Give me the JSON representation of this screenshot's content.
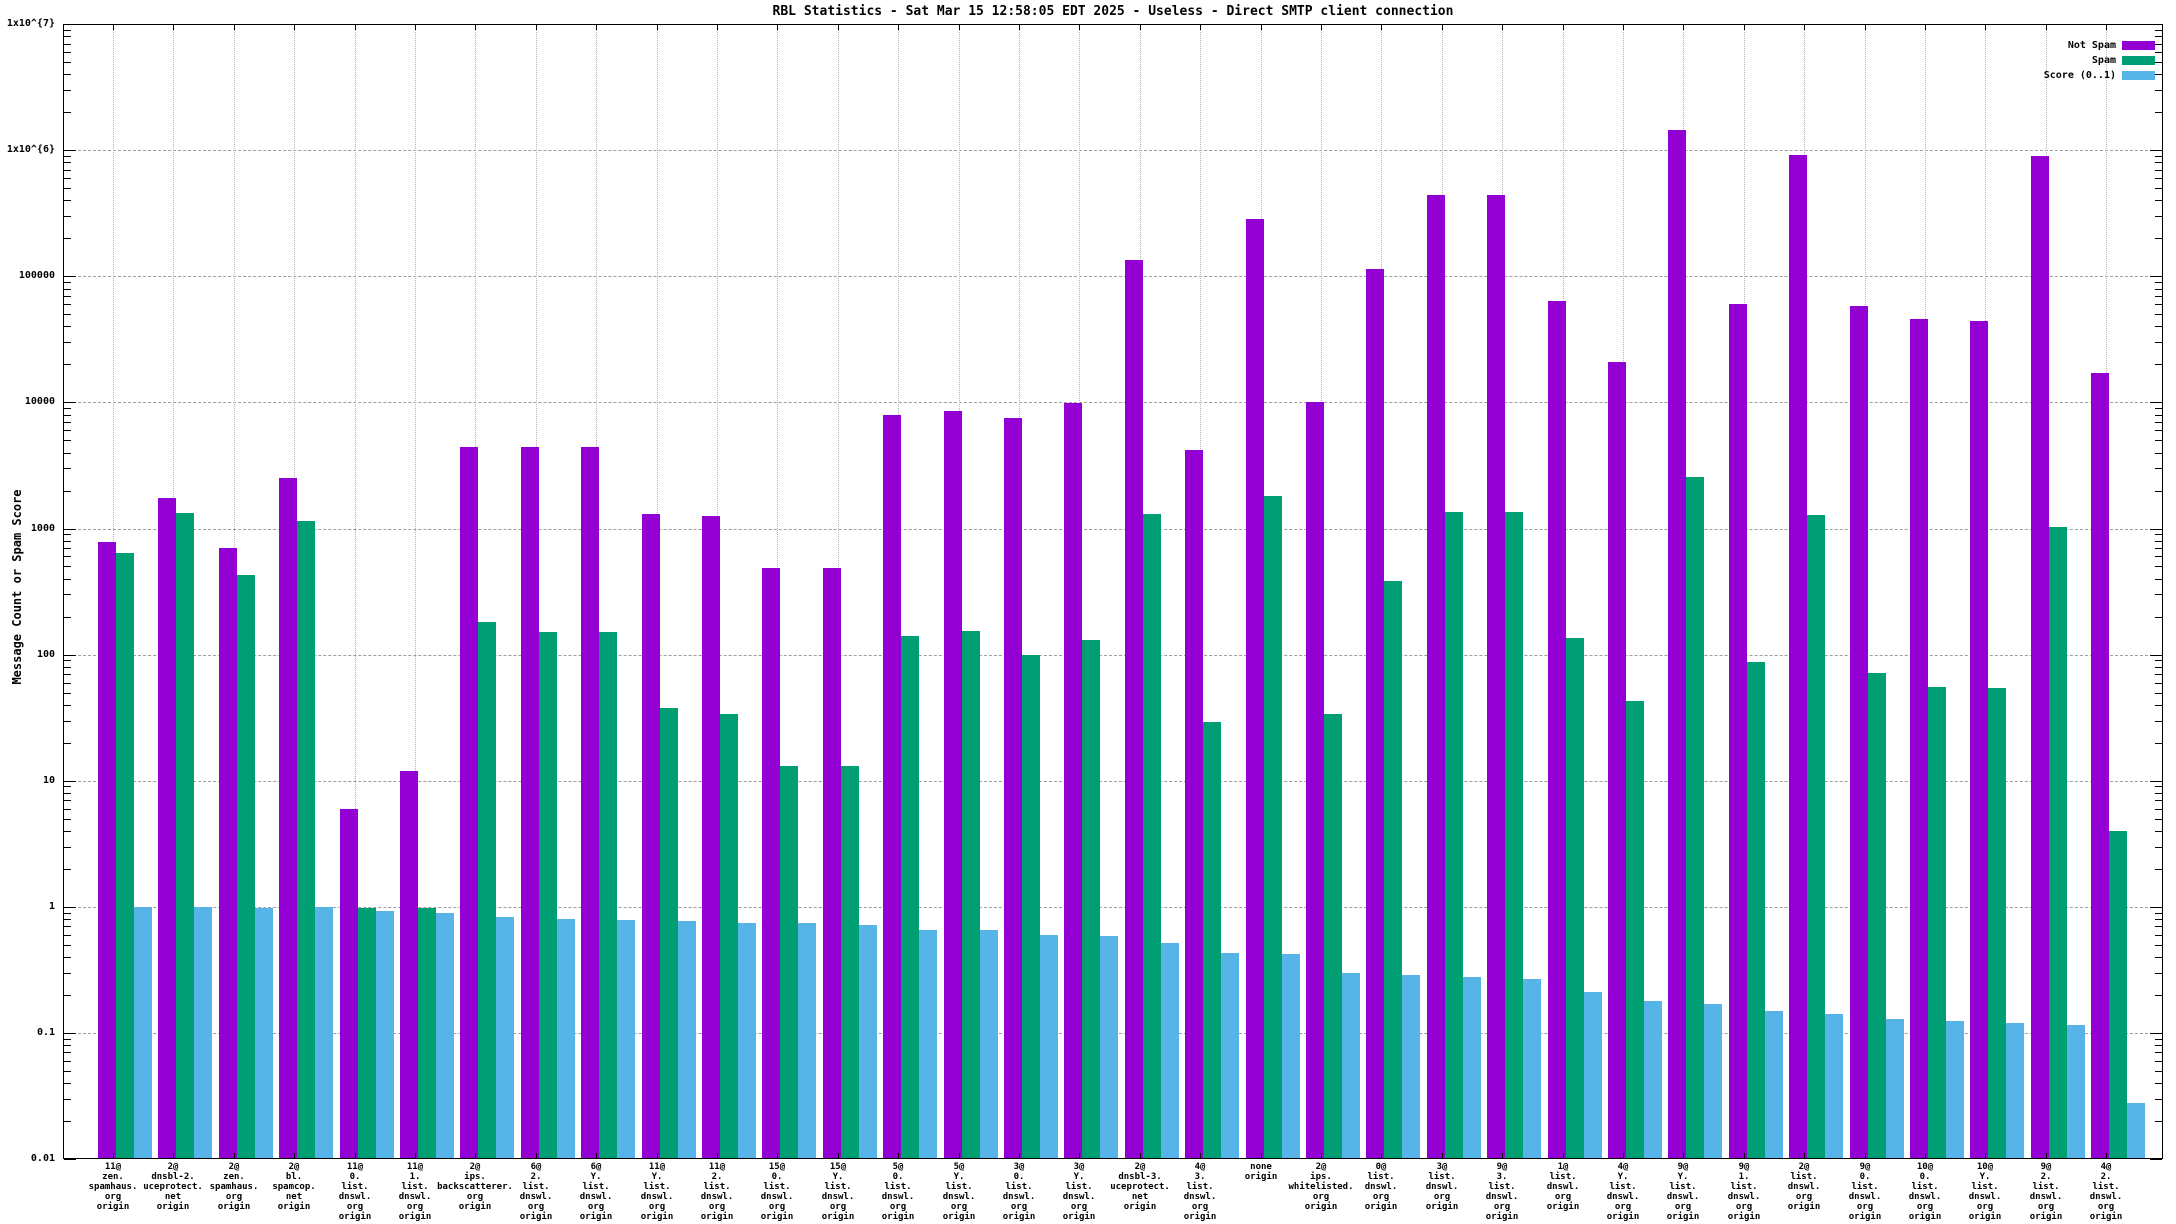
{
  "title": "RBL Statistics - Sat Mar 15 12:58:05 EDT 2025 - Useless - Direct SMTP client connection",
  "y_axis": {
    "label": "Message Count or Spam Score"
  },
  "chart_data": {
    "type": "bar",
    "y_scale": "log",
    "ylim": [
      0.01,
      10000000
    ],
    "grid": true,
    "legend_position": "top-right-inside",
    "title": "RBL Statistics - Sat Mar 15 12:58:05 EDT 2025 - Useless - Direct SMTP client connection",
    "xlabel": "",
    "ylabel": "Message Count or Spam Score",
    "y_ticks": [
      {
        "label": "1x10^{7}",
        "value": 10000000
      },
      {
        "label": "1x10^{6}",
        "value": 1000000
      },
      {
        "label": "100000",
        "value": 100000
      },
      {
        "label": "10000",
        "value": 10000
      },
      {
        "label": "1000",
        "value": 1000
      },
      {
        "label": "100",
        "value": 100
      },
      {
        "label": "10",
        "value": 10
      },
      {
        "label": "1",
        "value": 1
      },
      {
        "label": "0.1",
        "value": 0.1
      },
      {
        "label": "0.01",
        "value": 0.01
      }
    ],
    "categories": [
      "11@\nzen.\nspamhaus.\norg\norigin",
      "2@\ndnsbl-2.\nuceprotect.\nnet\norigin",
      "2@\nzen.\nspamhaus.\norg\norigin",
      "2@\nbl.\nspamcop.\nnet\norigin",
      "11@\n0.\nlist.\ndnswl.\norg\norigin",
      "11@\n1.\nlist.\ndnswl.\norg\norigin",
      "2@\nips.\nbackscatterer.\norg\norigin",
      "6@\n2.\nlist.\ndnswl.\norg\norigin",
      "6@\nY.\nlist.\ndnswl.\norg\norigin",
      "11@\nY.\nlist.\ndnswl.\norg\norigin",
      "11@\n2.\nlist.\ndnswl.\norg\norigin",
      "15@\n0.\nlist.\ndnswl.\norg\norigin",
      "15@\nY.\nlist.\ndnswl.\norg\norigin",
      "5@\n0.\nlist.\ndnswl.\norg\norigin",
      "5@\nY.\nlist.\ndnswl.\norg\norigin",
      "3@\n0.\nlist.\ndnswl.\norg\norigin",
      "3@\nY.\nlist.\ndnswl.\norg\norigin",
      "2@\ndnsbl-3.\nuceprotect.\nnet\norigin",
      "4@\n3.\nlist.\ndnswl.\norg\norigin",
      "none\norigin",
      "2@\nips.\nwhitelisted.\norg\norigin",
      "0@\nlist.\ndnswl.\norg\norigin",
      "3@\nlist.\ndnswl.\norg\norigin",
      "9@\n3.\nlist.\ndnswl.\norg\norigin",
      "1@\nlist.\ndnswl.\norg\norigin",
      "4@\nY.\nlist.\ndnswl.\norg\norigin",
      "9@\nY.\nlist.\ndnswl.\norg\norigin",
      "9@\n1.\nlist.\ndnswl.\norg\norigin",
      "2@\nlist.\ndnswl.\norg\norigin",
      "9@\n0.\nlist.\ndnswl.\norg\norigin",
      "10@\n0.\nlist.\ndnswl.\norg\norigin",
      "10@\nY.\nlist.\ndnswl.\norg\norigin",
      "9@\n2.\nlist.\ndnswl.\norg\norigin",
      "4@\n2.\nlist.\ndnswl.\norg\norigin"
    ],
    "series": [
      {
        "name": "Not Spam",
        "color": "#9400d3",
        "values": [
          780,
          1750,
          700,
          2500,
          6,
          12,
          4400,
          4400,
          4400,
          1300,
          1250,
          490,
          490,
          8000,
          8600,
          7500,
          9900,
          135000,
          4200,
          285000,
          10000,
          115000,
          440000,
          440000,
          64000,
          21000,
          1450000,
          60000,
          910000,
          58000,
          46000,
          44000,
          900000,
          17000
        ]
      },
      {
        "name": "Spam",
        "color": "#009e73",
        "values": [
          640,
          1330,
          430,
          1140,
          0.98,
          0.98,
          180,
          150,
          150,
          38,
          34,
          13,
          13,
          140,
          155,
          100,
          130,
          1300,
          29,
          1800,
          34,
          380,
          1350,
          1350,
          135,
          43,
          2550,
          87,
          1270,
          72,
          55,
          54,
          1020,
          4
        ]
      },
      {
        "name": "Score (0..1)",
        "color": "#56b4e9",
        "values": [
          0.99,
          0.99,
          0.98,
          0.99,
          0.93,
          0.9,
          0.83,
          0.8,
          0.79,
          0.77,
          0.75,
          0.74,
          0.72,
          0.66,
          0.65,
          0.6,
          0.59,
          0.52,
          0.43,
          0.42,
          0.3,
          0.29,
          0.28,
          0.27,
          0.21,
          0.18,
          0.17,
          0.15,
          0.14,
          0.13,
          0.125,
          0.12,
          0.115,
          0.028
        ]
      }
    ]
  }
}
